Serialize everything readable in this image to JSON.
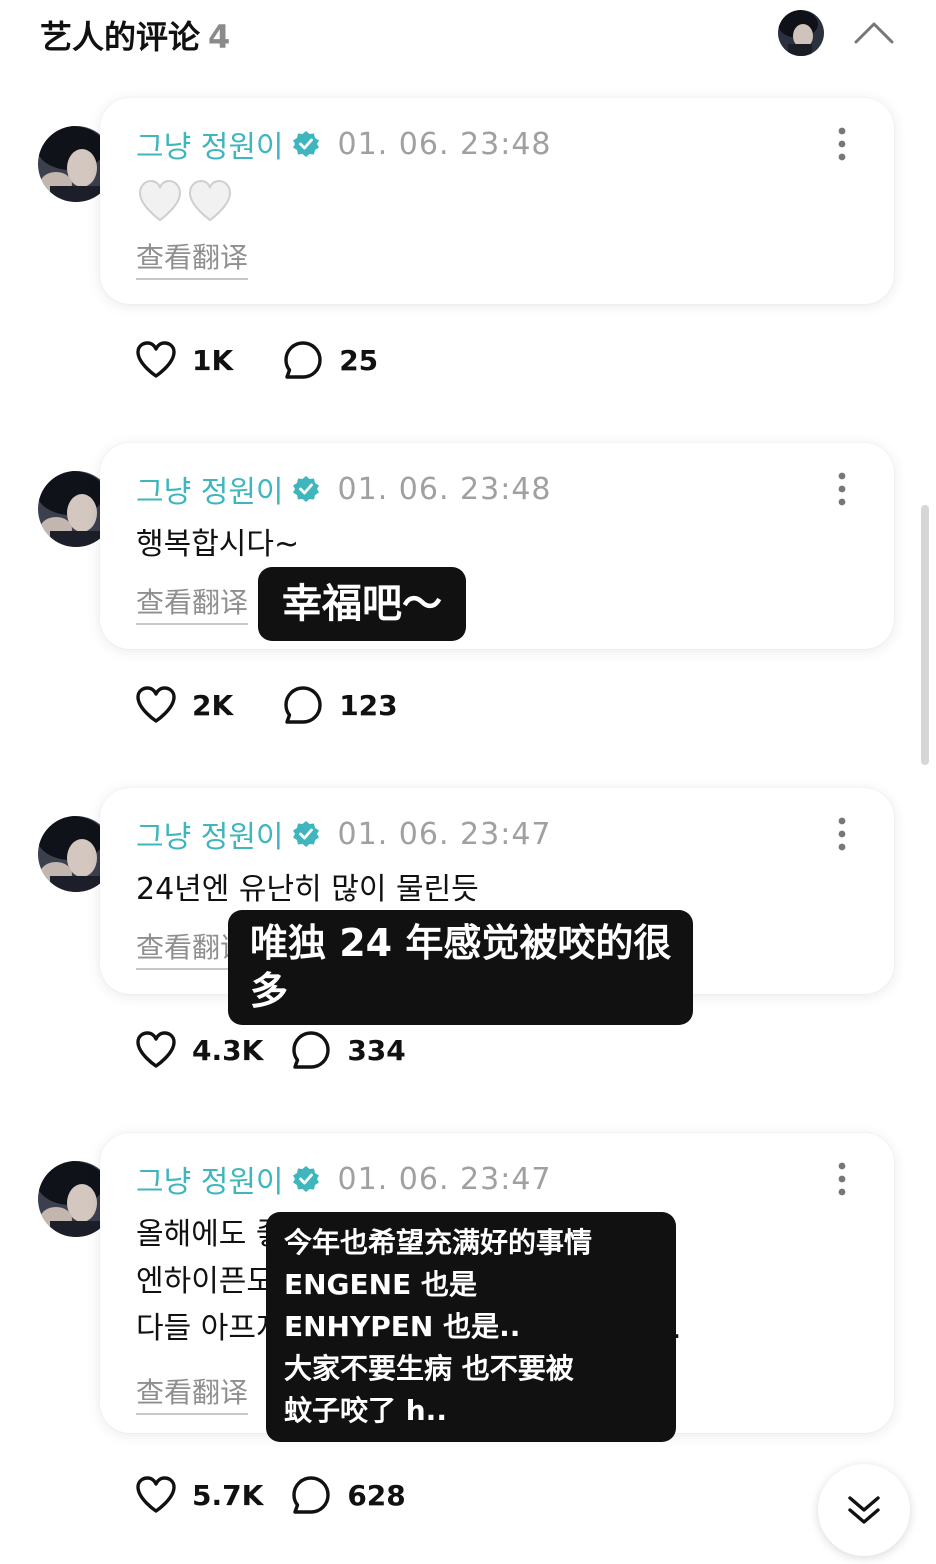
{
  "header": {
    "title": "艺人的评论",
    "count": "4"
  },
  "comments": [
    {
      "author": "그냥 정원이",
      "time": "01. 06. 23:48",
      "text_lines": [],
      "emoji": "heart-hearts",
      "translate": "查看翻译",
      "likes": "1K",
      "replies": "25"
    },
    {
      "author": "그냥 정원이",
      "time": "01. 06. 23:48",
      "text_lines": [
        "행복합시다~"
      ],
      "translate": "查看翻译",
      "likes": "2K",
      "replies": "123"
    },
    {
      "author": "그냥 정원이",
      "time": "01. 06. 23:47",
      "text_lines": [
        "24년엔 유난히 많이 물린듯"
      ],
      "translate": "查看翻译",
      "likes": "4.3K",
      "replies": "334"
    },
    {
      "author": "그냥 정원이",
      "time": "01. 06. 23:47",
      "text_lines": [
        "올해에도 좋은 일만 가득하길 바라 엔진도",
        "엔하이픈도..",
        "다들 아프지 말고 모기에게 물리지 말고 ㅎ.."
      ],
      "translate": "查看翻译",
      "likes": "5.7K",
      "replies": "628"
    }
  ],
  "overlays": [
    {
      "lines": [
        "幸福吧～"
      ]
    },
    {
      "lines": [
        "唯独 24 年感觉被咬的很",
        "多"
      ]
    },
    {
      "lines": [
        "今年也希望充满好的事情",
        "ENGENE 也是",
        "ENHYPEN 也是..",
        "大家不要生病 也不要被",
        "蚊子咬了 h.."
      ]
    }
  ],
  "colors": {
    "author": "#3fb6be",
    "verified": "#3fb6be",
    "time": "#a0a0a0",
    "overlay_bg": "#111111"
  }
}
